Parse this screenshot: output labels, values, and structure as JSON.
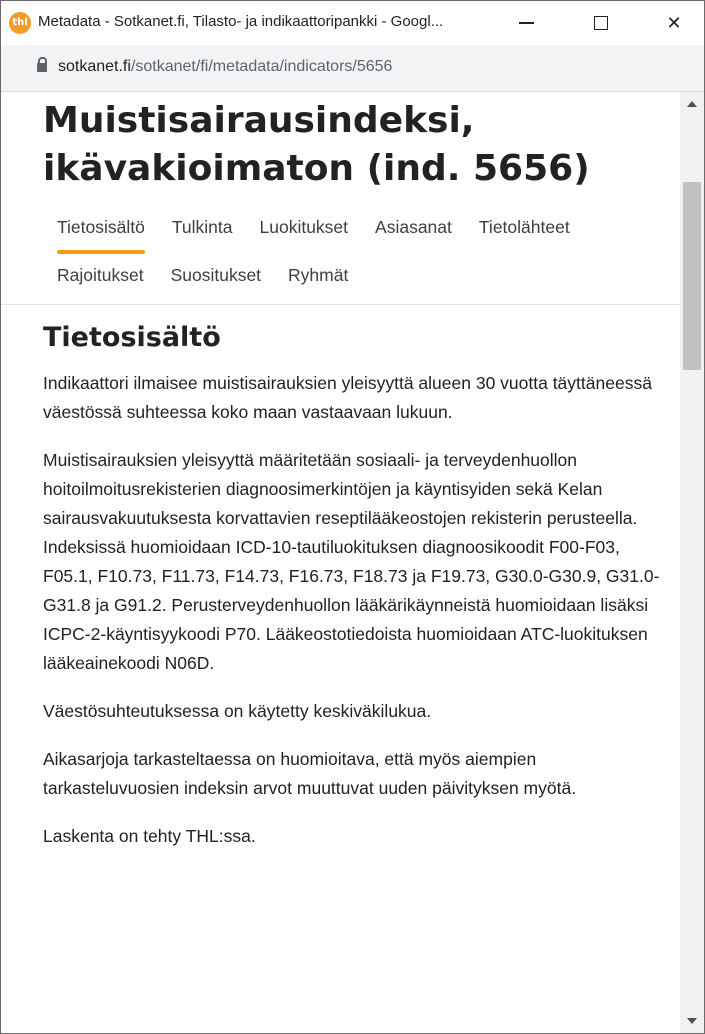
{
  "window": {
    "title": "Metadata - Sotkanet.fi, Tilasto- ja indikaattoripankki - Googl...",
    "favicon_text": "thl",
    "minimize_icon": "minimize-icon",
    "maximize_icon": "maximize-icon",
    "close_icon": "close-icon",
    "close_glyph": "✕"
  },
  "address_bar": {
    "lock_icon": "lock-icon",
    "host": "sotkanet.fi",
    "path": "/sotkanet/fi/metadata/indicators/5656"
  },
  "page": {
    "title_line1": "Muistisairausindeksi,",
    "title_line2": "ikävakioimaton (ind. 5656)",
    "tabs": [
      {
        "label": "Tietosisältö",
        "active": true
      },
      {
        "label": "Tulkinta"
      },
      {
        "label": "Luokitukset"
      },
      {
        "label": "Asiasanat"
      },
      {
        "label": "Tietolähteet"
      },
      {
        "label": "Rajoitukset"
      },
      {
        "label": "Suositukset"
      },
      {
        "label": "Ryhmät"
      }
    ],
    "accent_color": "#f39c12",
    "section_title": "Tietosisältö",
    "paragraphs": [
      "Indikaattori ilmaisee muistisairauksien yleisyyttä alueen 30 vuotta täyttäneessä väestössä suhteessa koko maan vastaavaan lukuun.",
      "Muistisairauksien yleisyyttä määritetään sosiaali- ja terveydenhuollon hoitoilmoitusrekisterien diagnoosimerkintöjen ja käyntisyiden sekä Kelan sairausvakuutuksesta korvattavien reseptilääkeostojen rekisterin perusteella. Indeksissä huomioidaan ICD-10-tautiluokituksen diagnoosikoodit F00-F03, F05.1, F10.73, F11.73, F14.73, F16.73, F18.73 ja F19.73, G30.0-G30.9, G31.0-G31.8 ja G91.2. Perusterveydenhuollon lääkärikäynneistä huomioidaan lisäksi ICPC-2-käyntisyykoodi P70. Lääkeostotiedoista huomioidaan ATC-luokituksen lääkeainekoodi N06D.",
      "Väestösuhteutuksessa on käytetty keskiväkilukua.",
      "Aikasarjoja tarkasteltaessa on huomioitava, että myös aiempien tarkasteluvuosien indeksin arvot muuttuvat uuden päivityksen myötä.",
      "Laskenta on tehty THL:ssa."
    ]
  }
}
